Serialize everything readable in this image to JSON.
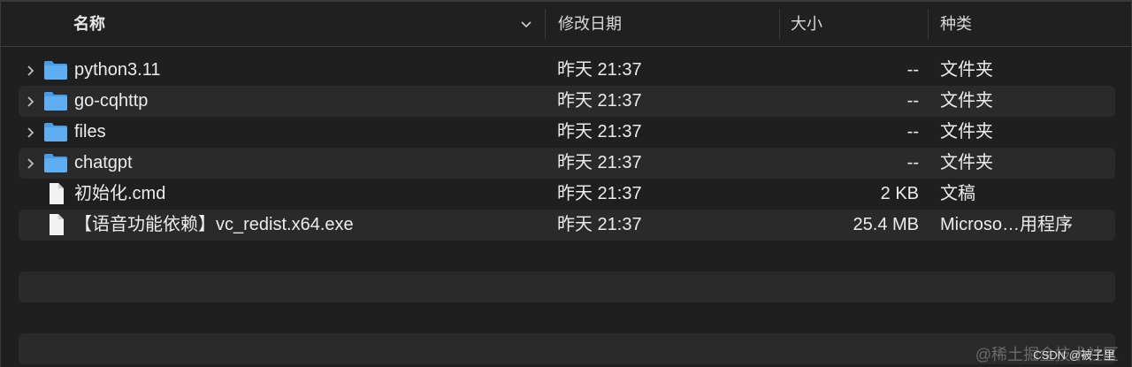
{
  "header": {
    "name_label": "名称",
    "date_label": "修改日期",
    "size_label": "大小",
    "kind_label": "种类"
  },
  "colors": {
    "folder_blue": "#5eaef2",
    "folder_tab": "#4a9be6",
    "doc_white": "#f2f2f2",
    "row_stripe": "#2a2a2a",
    "background": "#1f1f1f"
  },
  "files": [
    {
      "name": "python3.11",
      "date": "昨天 21:37",
      "size": "--",
      "kind": "文件夹",
      "icon": "folder-icon",
      "expandable": true
    },
    {
      "name": "go-cqhttp",
      "date": "昨天 21:37",
      "size": "--",
      "kind": "文件夹",
      "icon": "folder-icon",
      "expandable": true
    },
    {
      "name": "files",
      "date": "昨天 21:37",
      "size": "--",
      "kind": "文件夹",
      "icon": "folder-icon",
      "expandable": true
    },
    {
      "name": "chatgpt",
      "date": "昨天 21:37",
      "size": "--",
      "kind": "文件夹",
      "icon": "folder-icon",
      "expandable": true
    },
    {
      "name": "初始化.cmd",
      "date": "昨天 21:37",
      "size": "2 KB",
      "kind": "文稿",
      "icon": "document-icon",
      "expandable": false
    },
    {
      "name": "【语音功能依赖】vc_redist.x64.exe",
      "date": "昨天 21:37",
      "size": "25.4 MB",
      "kind": "Microso…用程序",
      "icon": "document-icon",
      "expandable": false
    }
  ],
  "watermark": {
    "text": "@稀土掘金技术社区",
    "csdn": "CSDN @被子里"
  }
}
